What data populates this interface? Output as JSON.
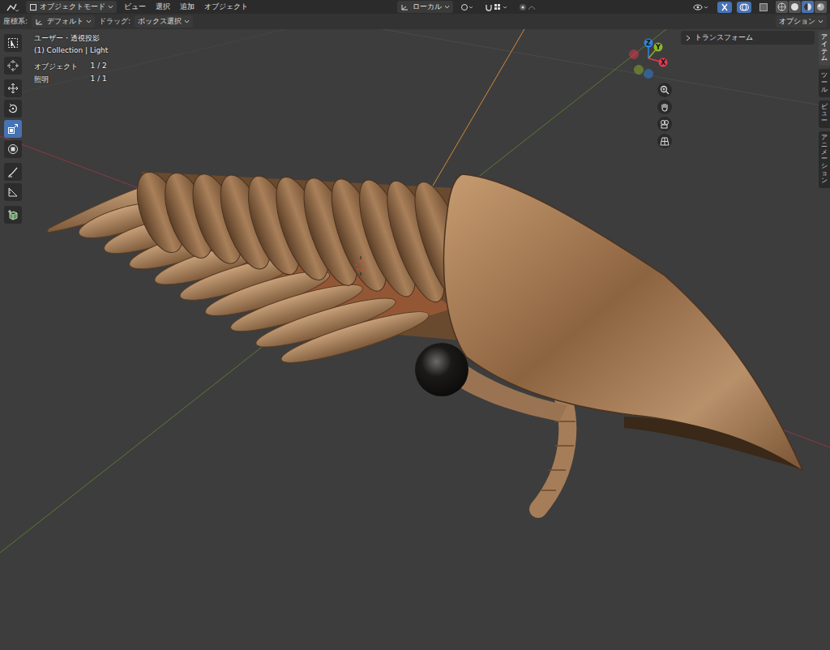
{
  "header": {
    "mode": "オブジェクトモード",
    "menus": [
      "ビュー",
      "選択",
      "追加",
      "オブジェクト"
    ],
    "orientation": "ローカル",
    "shading": [
      {
        "kind": "wireframe",
        "selected": false
      },
      {
        "kind": "solid",
        "selected": false
      },
      {
        "kind": "material",
        "selected": true
      },
      {
        "kind": "rendered",
        "selected": false
      }
    ]
  },
  "tool_settings": {
    "orientation_label": "座標系:",
    "orientation": "デフォルト",
    "drag_label": "ドラッグ:",
    "drag": "ボックス選択",
    "options": "オプション"
  },
  "toolbar": [
    {
      "kind": "select",
      "selected": false
    },
    {
      "kind": "cursor",
      "selected": false
    },
    {
      "kind": "move",
      "selected": false
    },
    {
      "kind": "rotate",
      "selected": false
    },
    {
      "kind": "scale",
      "selected": true
    },
    {
      "kind": "transform",
      "selected": false
    },
    {
      "kind": "annotate",
      "selected": false
    },
    {
      "kind": "measure",
      "selected": false
    },
    {
      "kind": "add-cube",
      "selected": false
    }
  ],
  "overlay": {
    "view": "ユーザー・透視投影",
    "collection": "(1) Collection | Light",
    "stats": [
      {
        "label": "オブジェクト",
        "value": "1 / 2"
      },
      {
        "label": "照明",
        "value": "1 / 1"
      }
    ]
  },
  "gizmo": {
    "axes": [
      {
        "label": "Z",
        "color": "#2f83e3"
      },
      {
        "label": "Y",
        "color": "#8bb32b"
      },
      {
        "label": "X",
        "color": "#e5394f"
      }
    ]
  },
  "sidebar": {
    "panel": "トランスフォーム",
    "expanded": false,
    "tabs": [
      {
        "label": "アイテム",
        "selected": true
      },
      {
        "label": "ツール",
        "selected": false
      },
      {
        "label": "ビュー",
        "selected": false
      },
      {
        "label": "アニメーション",
        "selected": false
      }
    ]
  }
}
